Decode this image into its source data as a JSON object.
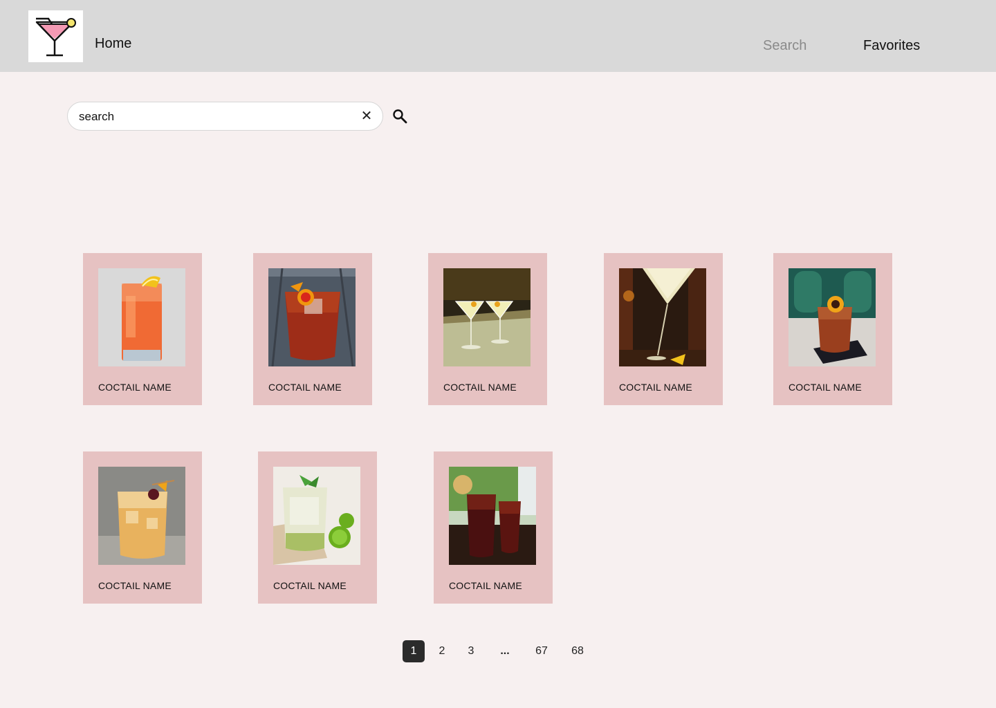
{
  "header": {
    "home_label": "Home",
    "nav": {
      "search_label": "Search",
      "favorites_label": "Favorites"
    }
  },
  "search": {
    "value": "search",
    "clear_glyph": "✕"
  },
  "cards": [
    {
      "name": "COCTAIL NAME",
      "photo": "tall-orange-highball-lemon"
    },
    {
      "name": "COCTAIL NAME",
      "photo": "amber-rocks-orange-twist"
    },
    {
      "name": "COCTAIL NAME",
      "photo": "two-martini-glasses-olive"
    },
    {
      "name": "COCTAIL NAME",
      "photo": "pale-martini-bar"
    },
    {
      "name": "COCTAIL NAME",
      "photo": "old-fashioned-orange-slice"
    },
    {
      "name": "COCTAIL NAME",
      "photo": "whiskey-sour-cherry"
    },
    {
      "name": "COCTAIL NAME",
      "photo": "mojito-mint-limes"
    },
    {
      "name": "COCTAIL NAME",
      "photo": "two-dark-iced-drinks"
    }
  ],
  "pagination": {
    "pages": [
      "1",
      "2",
      "3",
      "...",
      "67",
      "68"
    ],
    "current": "1"
  },
  "colors": {
    "header_bg": "#d9d9d9",
    "page_bg": "#f7f0f0",
    "card_bg": "#e6c2c2",
    "active_page_bg": "#2b2b2b",
    "nav_inactive": "#8a8a8a"
  },
  "icons": {
    "logo": "cocktail-glass-icon",
    "clear": "close-icon",
    "search": "search-icon"
  }
}
